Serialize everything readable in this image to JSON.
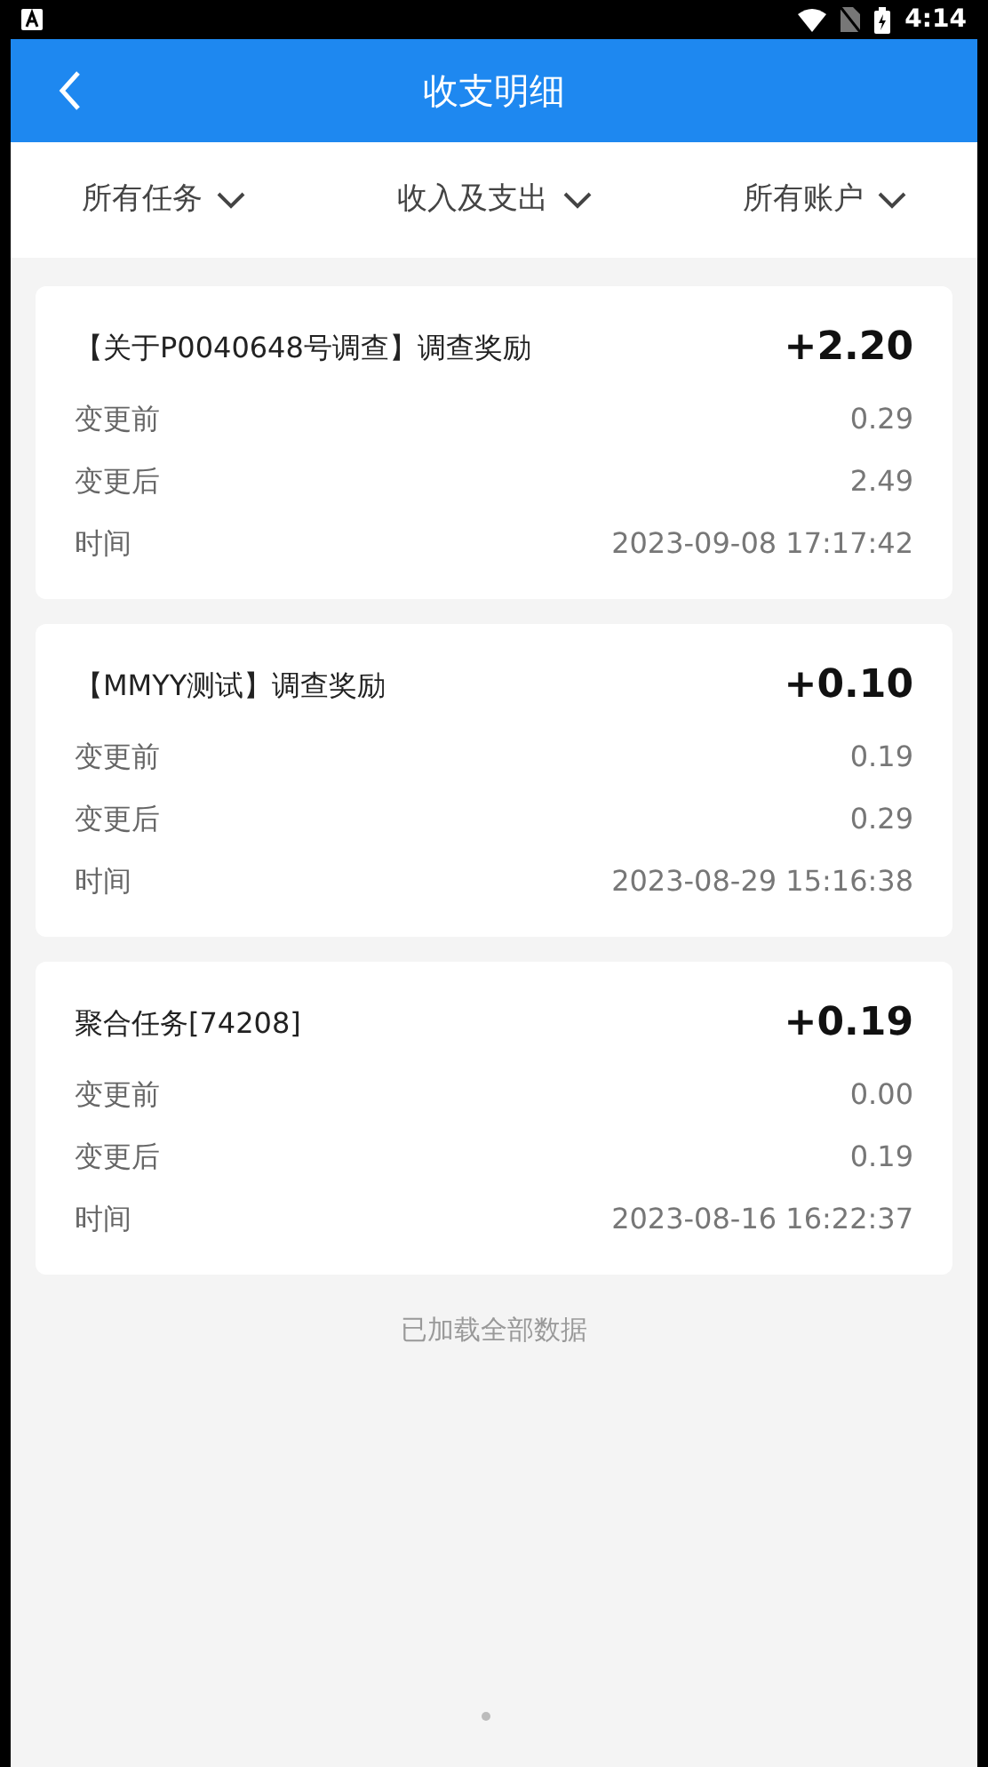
{
  "status_bar": {
    "time": "4:14"
  },
  "header": {
    "title": "收支明细"
  },
  "filters": [
    {
      "label": "所有任务"
    },
    {
      "label": "收入及支出"
    },
    {
      "label": "所有账户"
    }
  ],
  "records": [
    {
      "title": "【关于P0040648号调查】调查奖励",
      "amount": "+2.20",
      "rows": [
        {
          "label": "变更前",
          "value": "0.29"
        },
        {
          "label": "变更后",
          "value": "2.49"
        },
        {
          "label": "时间",
          "value": "2023-09-08 17:17:42"
        }
      ]
    },
    {
      "title": "【MMYY测试】调查奖励",
      "amount": "+0.10",
      "rows": [
        {
          "label": "变更前",
          "value": "0.19"
        },
        {
          "label": "变更后",
          "value": "0.29"
        },
        {
          "label": "时间",
          "value": "2023-08-29 15:16:38"
        }
      ]
    },
    {
      "title": "聚合任务[74208]",
      "amount": "+0.19",
      "rows": [
        {
          "label": "变更前",
          "value": "0.00"
        },
        {
          "label": "变更后",
          "value": "0.19"
        },
        {
          "label": "时间",
          "value": "2023-08-16 16:22:37"
        }
      ]
    }
  ],
  "footer_note": "已加载全部数据"
}
